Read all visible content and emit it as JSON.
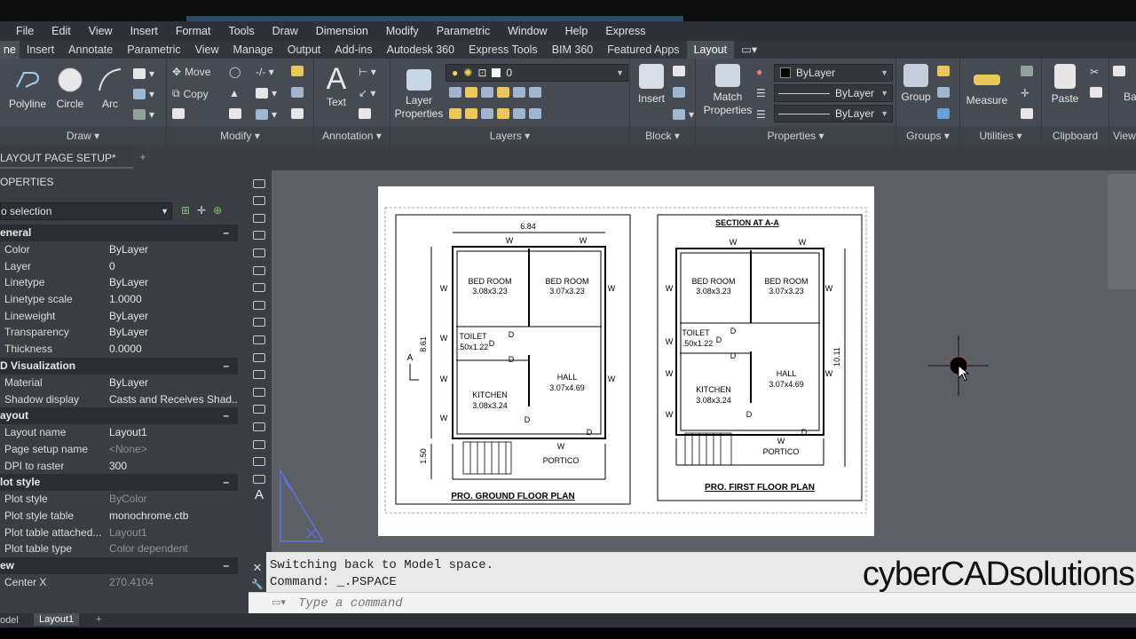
{
  "menu": [
    "File",
    "Edit",
    "View",
    "Insert",
    "Format",
    "Tools",
    "Draw",
    "Dimension",
    "Modify",
    "Parametric",
    "Window",
    "Help",
    "Express"
  ],
  "tabs": [
    "ne",
    "Insert",
    "Annotate",
    "Parametric",
    "View",
    "Manage",
    "Output",
    "Add-ins",
    "Autodesk 360",
    "Express Tools",
    "BIM 360",
    "Featured Apps",
    "Layout"
  ],
  "ribbon": {
    "draw": {
      "title": "Draw",
      "polyline": "Polyline",
      "circle": "Circle",
      "arc": "Arc"
    },
    "modify": {
      "title": "Modify",
      "move": "Move",
      "copy": "Copy"
    },
    "annotation": {
      "title": "Annotation",
      "text": "Text"
    },
    "layers": {
      "title": "Layers",
      "layer_properties": "Layer Properties",
      "layer_value": "0"
    },
    "block": {
      "title": "Block",
      "insert": "Insert"
    },
    "properties": {
      "title": "Properties",
      "match": "Match Properties",
      "color": "ByLayer",
      "linetype": "ByLayer",
      "lineweight": "ByLayer"
    },
    "groups": {
      "title": "Groups",
      "group": "Group"
    },
    "utilities": {
      "title": "Utilities",
      "measure": "Measure"
    },
    "clipboard": {
      "title": "Clipboard",
      "paste": "Paste"
    },
    "view": {
      "title": "View"
    }
  },
  "doc_tab": "LAYOUT PAGE SETUP*",
  "properties": {
    "header": "OPERTIES",
    "selection": "o selection",
    "sections": [
      {
        "name": "eneral",
        "rows": [
          {
            "k": "Color",
            "v": "ByLayer"
          },
          {
            "k": "Layer",
            "v": "0"
          },
          {
            "k": "Linetype",
            "v": "ByLayer"
          },
          {
            "k": "Linetype scale",
            "v": "1.0000"
          },
          {
            "k": "Lineweight",
            "v": "ByLayer"
          },
          {
            "k": "Transparency",
            "v": "ByLayer"
          },
          {
            "k": "Thickness",
            "v": "0.0000"
          }
        ]
      },
      {
        "name": "D Visualization",
        "rows": [
          {
            "k": "Material",
            "v": "ByLayer"
          },
          {
            "k": "Shadow display",
            "v": "Casts and Receives Shad..."
          }
        ]
      },
      {
        "name": "ayout",
        "rows": [
          {
            "k": "Layout name",
            "v": "Layout1"
          },
          {
            "k": "Page setup name",
            "v": "<None>"
          },
          {
            "k": "DPI to raster",
            "v": "300"
          }
        ]
      },
      {
        "name": "lot style",
        "rows": [
          {
            "k": "Plot style",
            "v": "ByColor"
          },
          {
            "k": "Plot style table",
            "v": "monochrome.ctb"
          },
          {
            "k": "Plot table attached...",
            "v": "Layout1"
          },
          {
            "k": "Plot table type",
            "v": "Color dependent"
          }
        ]
      },
      {
        "name": "ew",
        "rows": [
          {
            "k": "Center X",
            "v": "270.4104"
          }
        ]
      }
    ]
  },
  "drawing": {
    "left": {
      "title": "PRO. GROUND FLOOR PLAN",
      "width_dim": "6.84",
      "height_dim": "8.61",
      "stair_dim": "1.50",
      "rooms": [
        "BED ROOM",
        "3.08x3.23",
        "BED ROOM",
        "3.07x3.23",
        "TOILET",
        ".50x1.22",
        "KITCHEN",
        "3.08x3.24",
        "HALL",
        "3.07x4.69",
        "PORTICO"
      ]
    },
    "right": {
      "title": "PRO. FIRST FLOOR PLAN",
      "section": "SECTION AT  A-A",
      "height_dim": "10.11",
      "rooms": [
        "BED ROOM",
        "3.08x3.23",
        "BED ROOM",
        "3.07x3.23",
        "TOILET",
        ".50x1.22",
        "KITCHEN",
        "3.08x3.24",
        "HALL",
        "3.07x4.69",
        "PORTICO"
      ]
    },
    "north": "A",
    "w": "W",
    "d": "D"
  },
  "command": {
    "line1": "Switching back to Model space.",
    "line2": "Command:  _.PSPACE",
    "placeholder": "Type a command"
  },
  "brand": "cyberCADsolutions",
  "status_tabs": [
    "odel",
    "Layout1"
  ]
}
